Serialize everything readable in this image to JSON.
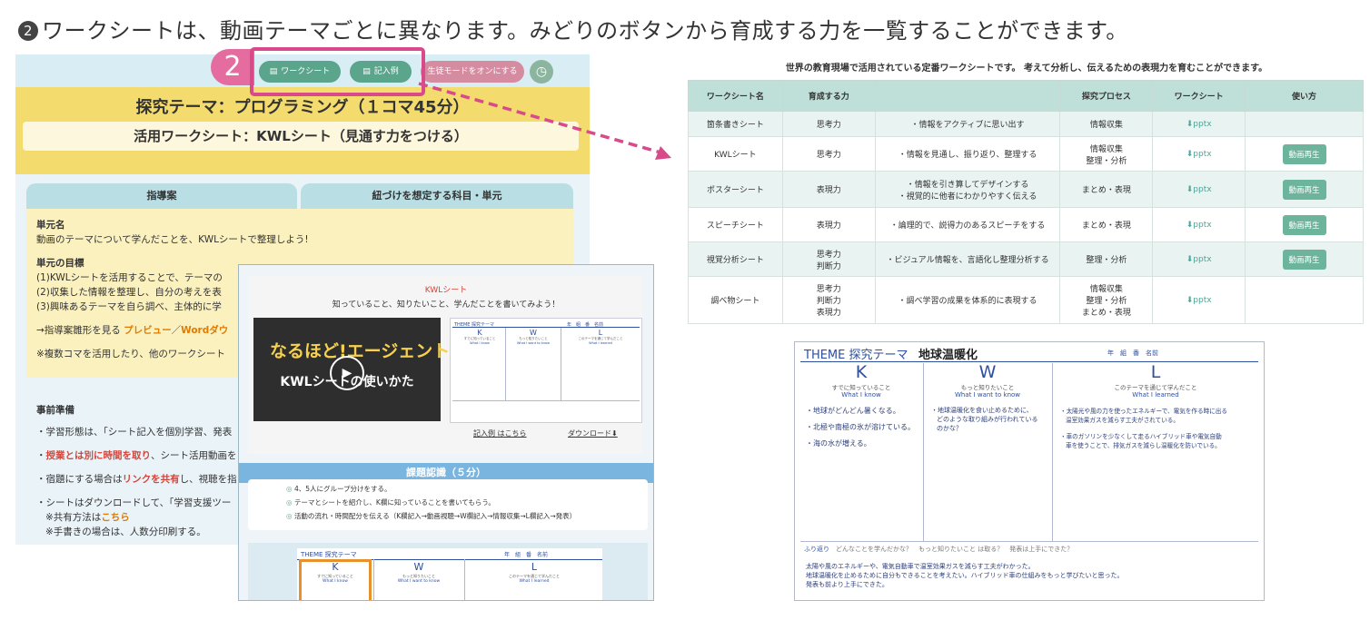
{
  "caption": {
    "num": "2",
    "text": "ワークシートは、動画テーマごとに異なります。みどりのボタンから育成する力を一覧することができます。"
  },
  "badge": {
    "num": "2"
  },
  "topbar": {
    "worksheet_btn": "ワークシート",
    "example_btn": "記入例",
    "student_mode_btn": "生徒モードをオンにする",
    "clock_icon": "clock-icon"
  },
  "theme": {
    "title": "探究テーマ：プログラミング（１コマ45分）",
    "worksheet": "活用ワークシート：KWLシート（見通す力をつける）"
  },
  "tabs": {
    "a": "指導案",
    "b": "紐づけを想定する科目・単元"
  },
  "unit": {
    "name_label": "単元名",
    "name_text": "動画のテーマについて学んだことを、KWLシートで整理しよう!",
    "goal_label": "単元の目標",
    "goals": [
      "(1)KWLシートを活用することで、テーマの",
      "(2)収集した情報を整理し、自分の考えを表",
      "(3)興味あるテーマを自ら調べ、主体的に学"
    ],
    "link_prefix": "→指導案雛形を見る ",
    "preview": "プレビュー",
    "slash": "／",
    "word": "Wordダウ",
    "note": "※複数コマを活用したり、他のワークシート"
  },
  "prep": {
    "label": "事前準備",
    "l1": "・学習形態は、「シート記入を個別学習、発表",
    "l2_pre": "・",
    "l2_red": "授業とは別に時間を取り",
    "l2_post": "、シート活用動画を",
    "l3_pre": "・宿題にする場合は",
    "l3_red": "リンクを共有",
    "l3_post": "し、視聴を指",
    "l4": "・シートはダウンロードして、「学習支援ツー",
    "l5_pre": "※共有方法は",
    "l5_red": "こちら",
    "l6": "※手書きの場合は、人数分印刷する。"
  },
  "overlay": {
    "title": "KWLシート",
    "subtitle": "知っていること、知りたいこと、学んだことを書いてみよう！",
    "video_logo": "なるほど!エージェント",
    "video_title": "KWLシートの使いかた",
    "example_link": "記入例 はこちら",
    "download_link": "ダウンロード⬇",
    "kadai": "課題認識（５分）",
    "steps": [
      "4、5人にグループ分けをする。",
      "テーマとシートを紹介し、K欄に知っていることを書いてもらう。",
      "活動の流れ・時間配分を伝える（K欄記入→動画視聴→W欄記入→情報収集→L欄記入→発表）"
    ],
    "mini_theme": "THEME 探究テーマ",
    "mini_k": "K",
    "mini_w": "W",
    "mini_l": "L",
    "mini_k_jp": "すでに知っていること",
    "mini_w_jp": "もっと知りたいこと",
    "mini_l_jp": "このテーマを通じて学んだこと",
    "mini_k_en": "What I know",
    "mini_w_en": "What I want to know",
    "mini_l_en": "What I learned",
    "mini_meta": "年　組　番　名前"
  },
  "table": {
    "caption": "世界の教育現場で活用されている定番ワークシートです。 考えて分析し、伝えるための表現力を育むことができます。",
    "headers": [
      "ワークシート名",
      "育成する力",
      "",
      "探究プロセス",
      "ワークシート",
      "使い方"
    ],
    "rows": [
      {
        "name": "箇条書きシート",
        "power": "思考力",
        "desc": "・情報をアクティブに思い出す",
        "process": "情報収集",
        "file": "⬇pptx",
        "use": ""
      },
      {
        "name": "KWLシート",
        "power": "思考力",
        "desc": "・情報を見通し、振り返り、整理する",
        "process": "情報収集\n整理・分析",
        "file": "⬇pptx",
        "use": "動画再生"
      },
      {
        "name": "ポスターシート",
        "power": "表現力",
        "desc": "・情報を引き算してデザインする\n・視覚的に他者にわかりやすく伝える",
        "process": "まとめ・表現",
        "file": "⬇pptx",
        "use": "動画再生"
      },
      {
        "name": "スピーチシート",
        "power": "表現力",
        "desc": "・論理的で、説得力のあるスピーチをする",
        "process": "まとめ・表現",
        "file": "⬇pptx",
        "use": "動画再生"
      },
      {
        "name": "視覚分析シート",
        "power": "思考力\n判断力",
        "desc": "・ビジュアル情報を、言語化し整理分析する",
        "process": "整理・分析",
        "file": "⬇pptx",
        "use": "動画再生"
      },
      {
        "name": "調べ物シート",
        "power": "思考力\n判断力\n表現力",
        "desc": "・調べ学習の成果を体系的に表現する",
        "process": "情報収集\n整理・分析\nまとめ・表現",
        "file": "⬇pptx",
        "use": ""
      }
    ]
  },
  "sheet": {
    "theme_label": "THEME 探究テーマ",
    "theme_value": "地球温暖化",
    "meta": "年　組　番　名前",
    "k": "K",
    "w": "W",
    "l": "L",
    "k_jp": "すでに知っていること",
    "w_jp": "もっと知りたいこと",
    "l_jp": "このテーマを通じて学んだこと",
    "k_en": "What I know",
    "w_en": "What I want to know",
    "l_en": "What I learned",
    "k_items": [
      "・地球がどんどん暑くなる。",
      "・北極や南極の氷が溶けている。",
      "・海の水が増える。"
    ],
    "w_items": [
      "・地球温暖化を食い止めるために、",
      "どのような取り組みが行われている",
      "のかな？"
    ],
    "l_items": [
      "・太陽光や風の力を使ったエネルギーで、電気を作る時に出る",
      "温室効果ガスを減らす工夫がされている。",
      "",
      "・車のガソリンを少なくして走るハイブリッド車や電気自動",
      "車を使うことで、排気ガスを減らし温暖化を防いでいる。"
    ],
    "reflect_label": "ふり返り",
    "reflect_q": "どんなことを学んだかな？　もっと知りたいこと は取る？　発表は上手にできた？",
    "reflect_items": [
      "太陽や風のエネルギーや、電気自動車で温室効果ガスを減らす工夫がわかった。",
      "地球温暖化を止めるために自分もできることを考えたい。ハイブリッド車の仕組みをもっと学びたいと思った。",
      "発表も前より上手にできた。"
    ]
  },
  "colors": {
    "accent_green": "#5aa58b",
    "highlight_pink": "#d94a8a",
    "theme_yellow": "#f3db6d"
  }
}
